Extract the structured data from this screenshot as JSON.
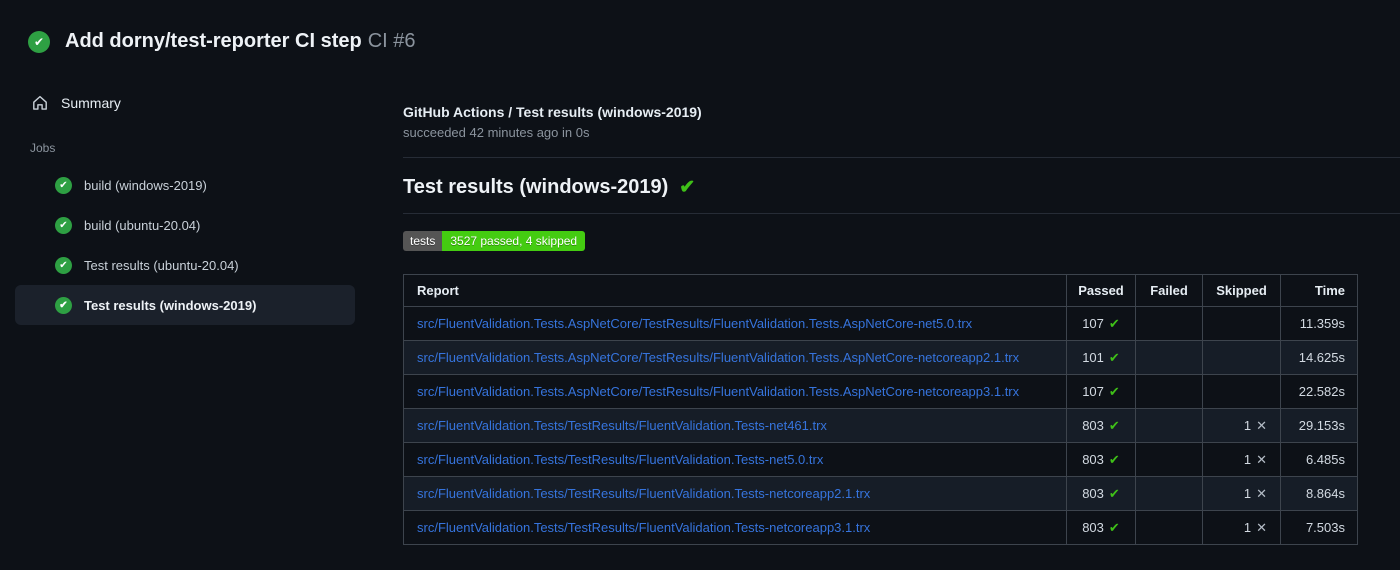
{
  "header": {
    "title": "Add dorny/test-reporter CI step",
    "run_number": "CI #6"
  },
  "sidebar": {
    "summary_label": "Summary",
    "jobs_label": "Jobs",
    "jobs": [
      {
        "label": "build (windows-2019)",
        "selected": false
      },
      {
        "label": "build (ubuntu-20.04)",
        "selected": false
      },
      {
        "label": "Test results (ubuntu-20.04)",
        "selected": false
      },
      {
        "label": "Test results (windows-2019)",
        "selected": true
      }
    ]
  },
  "main": {
    "check_title": "GitHub Actions / Test results (windows-2019)",
    "check_status": "succeeded 42 minutes ago in 0s",
    "section_heading": "Test results (windows-2019)",
    "badge": {
      "label": "tests",
      "value": "3527 passed, 4 skipped",
      "label_bg": "#555555",
      "value_bg": "#44cc11"
    },
    "table": {
      "headers": [
        "Report",
        "Passed",
        "Failed",
        "Skipped",
        "Time"
      ],
      "rows": [
        {
          "report": "src/FluentValidation.Tests.AspNetCore/TestResults/FluentValidation.Tests.AspNetCore-net5.0.trx",
          "passed": "107",
          "failed": "",
          "skipped": "",
          "time": "11.359s"
        },
        {
          "report": "src/FluentValidation.Tests.AspNetCore/TestResults/FluentValidation.Tests.AspNetCore-netcoreapp2.1.trx",
          "passed": "101",
          "failed": "",
          "skipped": "",
          "time": "14.625s"
        },
        {
          "report": "src/FluentValidation.Tests.AspNetCore/TestResults/FluentValidation.Tests.AspNetCore-netcoreapp3.1.trx",
          "passed": "107",
          "failed": "",
          "skipped": "",
          "time": "22.582s"
        },
        {
          "report": "src/FluentValidation.Tests/TestResults/FluentValidation.Tests-net461.trx",
          "passed": "803",
          "failed": "",
          "skipped": "1",
          "time": "29.153s"
        },
        {
          "report": "src/FluentValidation.Tests/TestResults/FluentValidation.Tests-net5.0.trx",
          "passed": "803",
          "failed": "",
          "skipped": "1",
          "time": "6.485s"
        },
        {
          "report": "src/FluentValidation.Tests/TestResults/FluentValidation.Tests-netcoreapp2.1.trx",
          "passed": "803",
          "failed": "",
          "skipped": "1",
          "time": "8.864s"
        },
        {
          "report": "src/FluentValidation.Tests/TestResults/FluentValidation.Tests-netcoreapp3.1.trx",
          "passed": "803",
          "failed": "",
          "skipped": "1",
          "time": "7.503s"
        }
      ]
    }
  },
  "glyphs": {
    "check": "✔",
    "cross": "✕"
  },
  "colors": {
    "page_bg": "#0d1117",
    "success_green": "#2ea043",
    "check_green": "#3fc018",
    "link_blue": "#3674dd",
    "table_border": "#3d444d",
    "row_alt_bg": "#161d27",
    "selected_item_bg": "#1b212b"
  }
}
